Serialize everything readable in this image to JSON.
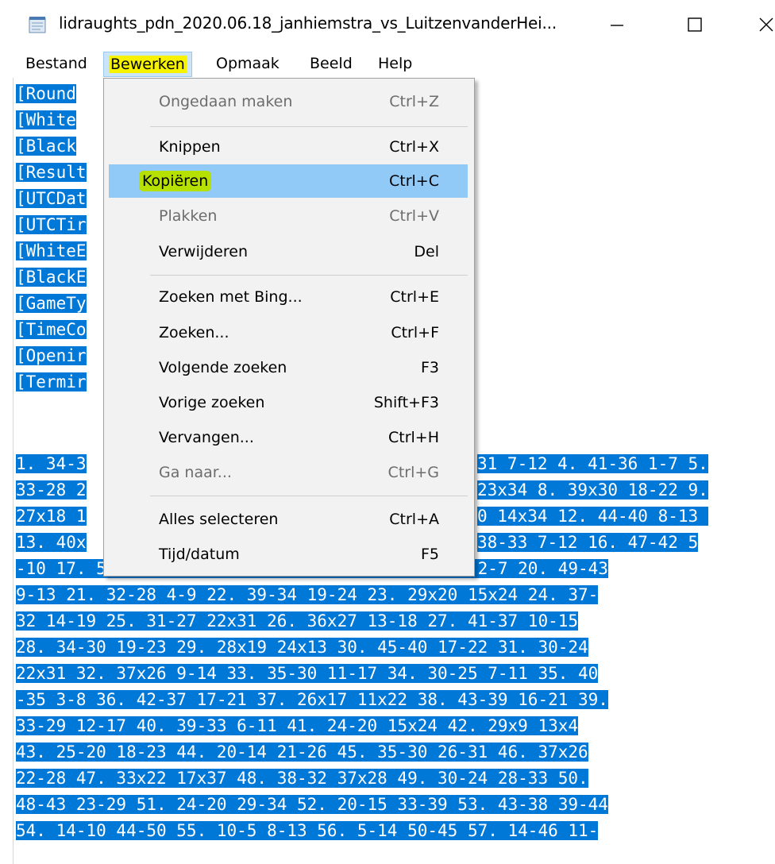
{
  "window": {
    "title": "lidraughts_pdn_2020.06.18_janhiemstra_vs_LuitzenvanderHei...",
    "minimize_icon": "minimize-icon",
    "maximize_icon": "maximize-icon",
    "close_icon": "close-icon"
  },
  "menubar": {
    "items": [
      "Bestand",
      "Bewerken",
      "Opmaak",
      "Beeld",
      "Help"
    ]
  },
  "editor": {
    "header_lines": [
      "[Round",
      "[White",
      "[Black",
      "[Result",
      "[UTCDat",
      "[UTCTir",
      "[WhiteE",
      "[BlackE",
      "[GameTy",
      "[TimeCo",
      "[Openir",
      "[Termir"
    ],
    "move_lines": [
      {
        "left": "1. 34-3",
        "right": "31 7-12 4. 41-36 1-7 5."
      },
      {
        "left": "33-28 2",
        "right": "23x34 8. 39x30 18-22 9."
      },
      {
        "left": "27x18 1",
        "right": "0 14x34 12. 44-40 8-13 "
      },
      {
        "left": "13. 40x",
        "right": "38-33 7-12 16. 47-42 5"
      },
      {
        "left": "-10 17. 50-44 18-22 18. 44-39 13-19 19. 43-38 2-7 20. 49-43",
        "right": ""
      },
      {
        "left": "9-13 21. 32-28 4-9 22. 39-34 19-24 23. 29x20 15x24 24. 37-",
        "right": ""
      },
      {
        "left": "32 14-19 25. 31-27 22x31 26. 36x27 13-18 27. 41-37 10-15",
        "right": ""
      },
      {
        "left": "28. 34-30 19-23 29. 28x19 24x13 30. 45-40 17-22 31. 30-24",
        "right": ""
      },
      {
        "left": "22x31 32. 37x26 9-14 33. 35-30 11-17 34. 30-25 7-11 35. 40",
        "right": ""
      },
      {
        "left": "-35 3-8 36. 42-37 17-21 37. 26x17 11x22 38. 43-39 16-21 39.",
        "right": ""
      },
      {
        "left": "33-29 12-17 40. 39-33 6-11 41. 24-20 15x24 42. 29x9 13x4",
        "right": ""
      },
      {
        "left": "43. 25-20 18-23 44. 20-14 21-26 45. 35-30 26-31 46. 37x26",
        "right": ""
      },
      {
        "left": "22-28 47. 33x22 17x37 48. 38-32 37x28 49. 30-24 28-33 50.",
        "right": ""
      },
      {
        "left": "48-43 23-29 51. 24-20 29-34 52. 20-15 33-39 53. 43-38 39-44",
        "right": ""
      },
      {
        "left": "54. 14-10 44-50 55. 10-5 8-13 56. 5-14 50-45 57. 14-46 11-",
        "right": ""
      }
    ]
  },
  "edit_menu": {
    "items": [
      {
        "label": "Ongedaan maken",
        "shortcut": "Ctrl+Z",
        "disabled": true
      },
      {
        "label": "Knippen",
        "shortcut": "Ctrl+X",
        "disabled": false
      },
      {
        "label": "Kopiëren",
        "shortcut": "Ctrl+C",
        "disabled": false
      },
      {
        "label": "Plakken",
        "shortcut": "Ctrl+V",
        "disabled": true
      },
      {
        "label": "Verwijderen",
        "shortcut": "Del",
        "disabled": false
      },
      {
        "label": "Zoeken met Bing...",
        "shortcut": "Ctrl+E",
        "disabled": false
      },
      {
        "label": "Zoeken...",
        "shortcut": "Ctrl+F",
        "disabled": false
      },
      {
        "label": "Volgende zoeken",
        "shortcut": "F3",
        "disabled": false
      },
      {
        "label": "Vorige zoeken",
        "shortcut": "Shift+F3",
        "disabled": false
      },
      {
        "label": "Vervangen...",
        "shortcut": "Ctrl+H",
        "disabled": false
      },
      {
        "label": "Ga naar...",
        "shortcut": "Ctrl+G",
        "disabled": true
      },
      {
        "label": "Alles selecteren",
        "shortcut": "Ctrl+A",
        "disabled": false
      },
      {
        "label": "Tijd/datum",
        "shortcut": "F5",
        "disabled": false
      }
    ]
  },
  "colors": {
    "selection": "#0078d7",
    "menu_hover": "#91c9f7",
    "highlight_yellow": "#f7f300",
    "highlight_green": "#b6e000"
  }
}
